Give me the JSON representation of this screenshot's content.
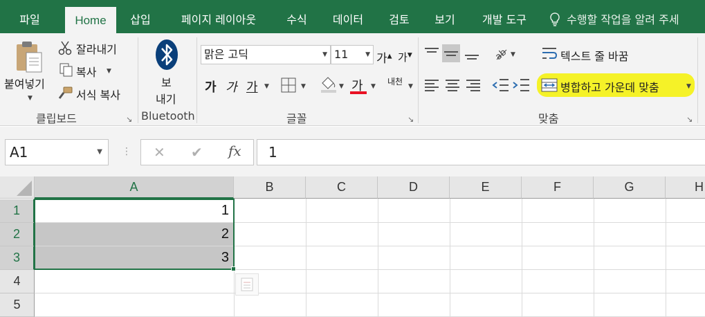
{
  "tabs": [
    {
      "label": "파일",
      "active": false
    },
    {
      "label": "Home",
      "active": true
    },
    {
      "label": "삽입",
      "active": false
    },
    {
      "label": "페이지 레이아웃",
      "active": false
    },
    {
      "label": "수식",
      "active": false
    },
    {
      "label": "데이터",
      "active": false
    },
    {
      "label": "검토",
      "active": false
    },
    {
      "label": "보기",
      "active": false
    },
    {
      "label": "개발 도구",
      "active": false
    }
  ],
  "tell_me": "수행할 작업을 알려 주세",
  "clipboard": {
    "paste": "붙여넣기",
    "cut": "잘라내기",
    "copy": "복사",
    "format_painter": "서식 복사",
    "group_label": "클립보드"
  },
  "bluetooth": {
    "send_line1": "보",
    "send_line2": "내기",
    "group_label": "Bluetooth"
  },
  "font": {
    "name": "맑은 고딕",
    "size": "11",
    "grow": "가",
    "shrink": "가",
    "bold": "가",
    "italic": "가",
    "underline": "가",
    "font_color": "가",
    "phonetic": "내천",
    "group_label": "글꼴",
    "font_color_hex": "#e81123"
  },
  "alignment": {
    "wrap_text": "텍스트 줄 바꿈",
    "merge_center": "병합하고 가운데 맞춤",
    "group_label": "맞춤",
    "highlight_hex": "#f5f228"
  },
  "formula_bar": {
    "name_box": "A1",
    "cancel": "✕",
    "enter": "✔",
    "fx": "fx",
    "value": "1"
  },
  "columns": [
    "A",
    "B",
    "C",
    "D",
    "E",
    "F",
    "G",
    "H"
  ],
  "rows": [
    "1",
    "2",
    "3",
    "4",
    "5"
  ],
  "cells": {
    "A1": "1",
    "A2": "2",
    "A3": "3"
  },
  "theme": {
    "accent": "#217346"
  }
}
